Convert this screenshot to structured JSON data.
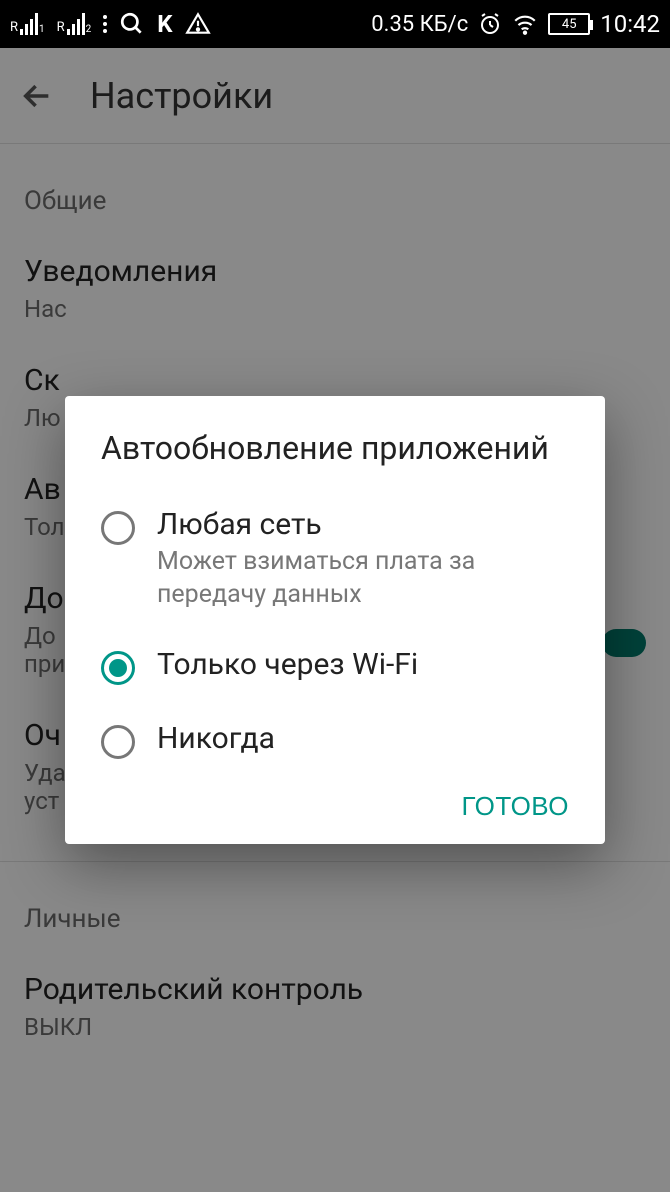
{
  "status": {
    "sim1_sub": "1",
    "sim2_sub": "2",
    "speed": "0.35 КБ/с",
    "battery": "45",
    "time": "10:42",
    "letter_k": "K"
  },
  "header": {
    "title": "Настройки"
  },
  "sections": {
    "general_label": "Общие",
    "notifications": {
      "title": "Уведомления",
      "sub": "Нас"
    },
    "downloads": {
      "title": "Ск",
      "sub": "Лю"
    },
    "autoupdate": {
      "title": "Ав",
      "sub": "Тол"
    },
    "addicons": {
      "title": "До",
      "sub": "До\nпри"
    },
    "clear": {
      "title": "Оч",
      "sub": "Уда\nуст"
    },
    "personal_label": "Личные",
    "parental": {
      "title": "Родительский контроль",
      "sub": "ВЫКЛ"
    }
  },
  "dialog": {
    "title": "Автообновление приложений",
    "opts": [
      {
        "label": "Любая сеть",
        "sub": "Может взиматься плата за передачу данных",
        "selected": false
      },
      {
        "label": "Только через Wi-Fi",
        "sub": "",
        "selected": true
      },
      {
        "label": "Никогда",
        "sub": "",
        "selected": false
      }
    ],
    "done": "ГОТОВО"
  }
}
